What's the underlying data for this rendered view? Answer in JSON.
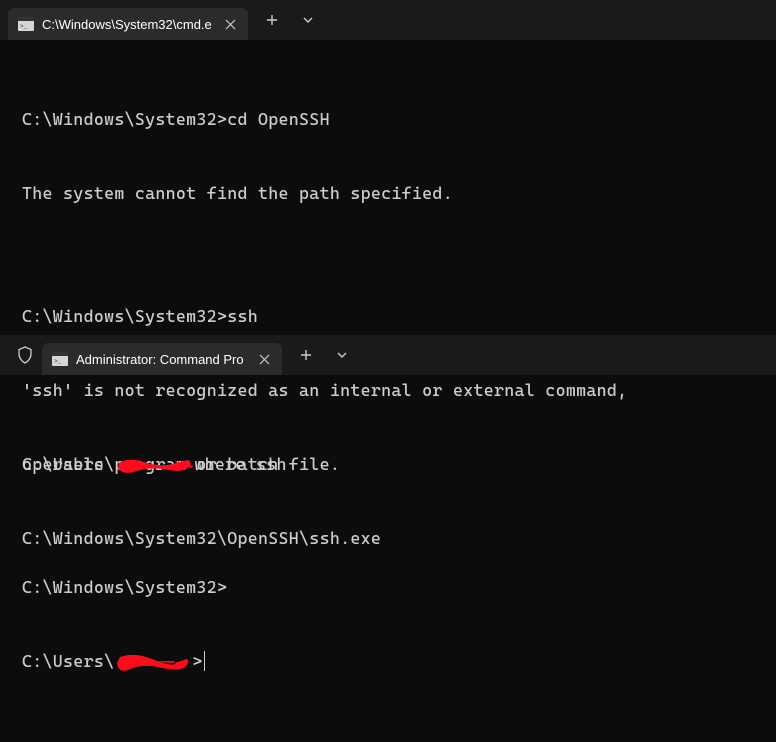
{
  "window1": {
    "tab": {
      "title": "C:\\Windows\\System32\\cmd.e"
    },
    "lines": {
      "l0": "C:\\Windows\\System32>cd OpenSSH",
      "l1": "The system cannot find the path specified.",
      "l2": "",
      "l3": "C:\\Windows\\System32>ssh",
      "l4": "'ssh' is not recognized as an internal or external command,",
      "l5": "operable program or batch file.",
      "l6": "",
      "l7": "C:\\Windows\\System32>"
    }
  },
  "window2": {
    "tab": {
      "title": "Administrator: Command Pro"
    },
    "lines": {
      "p1a": "C:\\Users\\",
      "p1b": "where ssh",
      "l1": "C:\\Windows\\System32\\OpenSSH\\ssh.exe",
      "l2": "",
      "p2a": "C:\\Users\\",
      "p2b": ">"
    }
  },
  "icons": {
    "plus": "+",
    "chevron": "⌄",
    "close": "✕"
  }
}
